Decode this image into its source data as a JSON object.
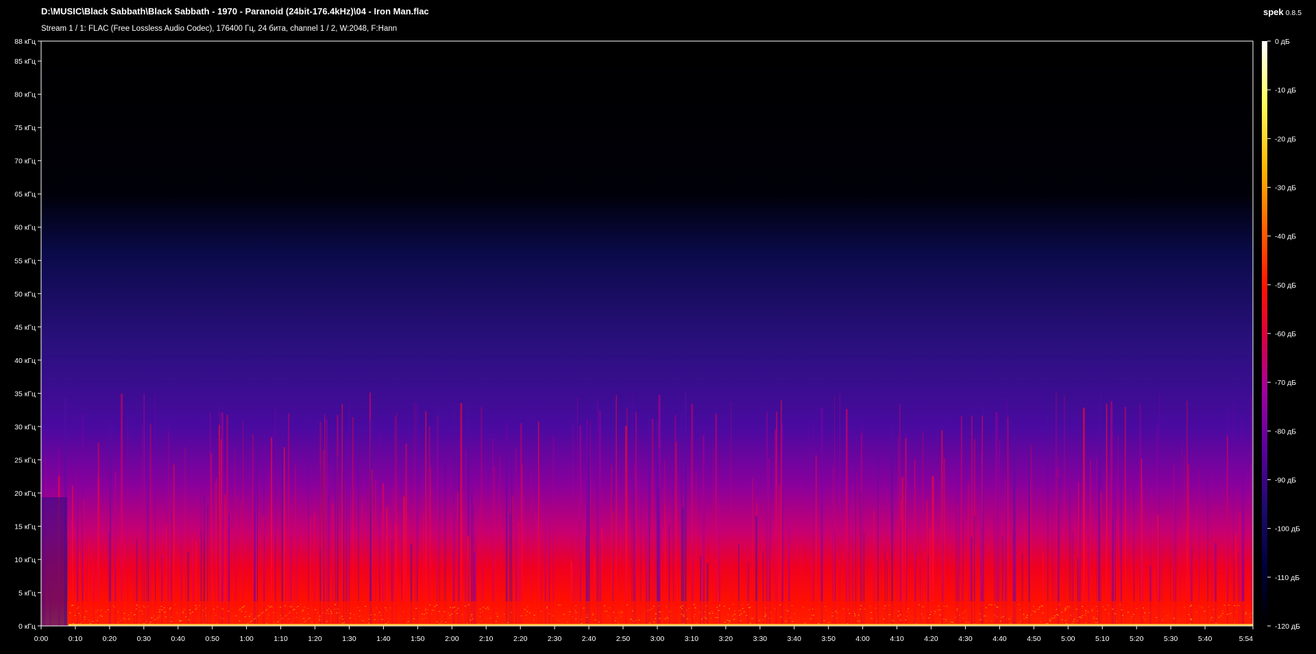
{
  "header": {
    "file_path": "D:\\MUSIC\\Black Sabbath\\Black Sabbath - 1970 - Paranoid (24bit-176.4kHz)\\04 - Iron Man.flac",
    "stream_info": "Stream 1 / 1: FLAC (Free Lossless Audio Codec), 176400 Гц, 24 бита, channel 1 / 2, W:2048, F:Hann",
    "app_name": "spek",
    "app_version": "0.8.5"
  },
  "colors": {
    "background": "#000000",
    "axis": "#ffffff",
    "palette": [
      "#000000",
      "#00003a",
      "#1c0a6e",
      "#5a00a0",
      "#a000a0",
      "#e0003c",
      "#ff1400",
      "#ff6000",
      "#ffb400",
      "#ffff60",
      "#ffffff"
    ]
  },
  "chart_data": {
    "type": "heatmap",
    "title": "",
    "xlabel": "",
    "ylabel": "",
    "xlim": [
      "0:00",
      "5:54"
    ],
    "ylim": [
      0,
      88
    ],
    "x_ticks": [
      "0:00",
      "0:10",
      "0:20",
      "0:30",
      "0:40",
      "0:50",
      "1:00",
      "1:10",
      "1:20",
      "1:30",
      "1:40",
      "1:50",
      "2:00",
      "2:10",
      "2:20",
      "2:30",
      "2:40",
      "2:50",
      "3:00",
      "3:10",
      "3:20",
      "3:30",
      "3:40",
      "3:50",
      "4:00",
      "4:10",
      "4:20",
      "4:30",
      "4:40",
      "4:50",
      "5:00",
      "5:10",
      "5:20",
      "5:30",
      "5:40",
      "5:54"
    ],
    "y_ticks": [
      {
        "v": 0,
        "label": "0 кГц"
      },
      {
        "v": 5,
        "label": "5 кГц"
      },
      {
        "v": 10,
        "label": "10 кГц"
      },
      {
        "v": 15,
        "label": "15 кГц"
      },
      {
        "v": 20,
        "label": "20 кГц"
      },
      {
        "v": 25,
        "label": "25 кГц"
      },
      {
        "v": 30,
        "label": "30 кГц"
      },
      {
        "v": 35,
        "label": "35 кГц"
      },
      {
        "v": 40,
        "label": "40 кГц"
      },
      {
        "v": 45,
        "label": "45 кГц"
      },
      {
        "v": 50,
        "label": "50 кГц"
      },
      {
        "v": 55,
        "label": "55 кГц"
      },
      {
        "v": 60,
        "label": "60 кГц"
      },
      {
        "v": 65,
        "label": "65 кГц"
      },
      {
        "v": 70,
        "label": "70 кГц"
      },
      {
        "v": 75,
        "label": "75 кГц"
      },
      {
        "v": 80,
        "label": "80 кГц"
      },
      {
        "v": 85,
        "label": "85 кГц"
      },
      {
        "v": 88,
        "label": "88 кГц"
      }
    ],
    "colorbar": {
      "range_db": [
        -120,
        0
      ],
      "ticks": [
        {
          "v": 0,
          "label": "0 дБ"
        },
        {
          "v": -10,
          "label": "-10 дБ"
        },
        {
          "v": -20,
          "label": "-20 дБ"
        },
        {
          "v": -30,
          "label": "-30 дБ"
        },
        {
          "v": -40,
          "label": "-40 дБ"
        },
        {
          "v": -50,
          "label": "-50 дБ"
        },
        {
          "v": -60,
          "label": "-60 дБ"
        },
        {
          "v": -70,
          "label": "-70 дБ"
        },
        {
          "v": -80,
          "label": "-80 дБ"
        },
        {
          "v": -90,
          "label": "-90 дБ"
        },
        {
          "v": -100,
          "label": "-100 дБ"
        },
        {
          "v": -110,
          "label": "-110 дБ"
        },
        {
          "v": -120,
          "label": "-120 дБ"
        }
      ]
    }
  }
}
